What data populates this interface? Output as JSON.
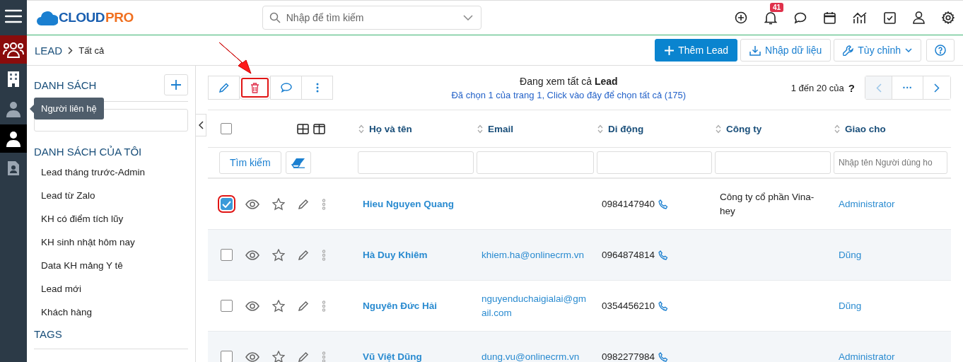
{
  "logo": {
    "part_1": "CLOUD",
    "part_2": "PRO"
  },
  "search": {
    "placeholder": "Nhập để tìm kiếm"
  },
  "notifications": {
    "count": "41"
  },
  "rail": [
    {
      "kind": "menu",
      "selected": false,
      "hovered": false
    },
    {
      "kind": "people",
      "selected": true,
      "hovered": false
    },
    {
      "kind": "building",
      "selected": false,
      "hovered": false
    },
    {
      "kind": "contact",
      "selected": false,
      "hovered": false
    },
    {
      "kind": "person",
      "selected": false,
      "hovered": true
    },
    {
      "kind": "document",
      "selected": false,
      "hovered": false
    }
  ],
  "tooltip": "Người liên hệ",
  "breadcrumb": {
    "module": "LEAD",
    "current": "Tất cả"
  },
  "actions": {
    "add": "Thêm Lead",
    "import": "Nhập dữ liệu",
    "customize": "Tùy chỉnh"
  },
  "sidebar": {
    "title": "DANH SÁCH",
    "my_lists_title": "DANH SÁCH CỦA TÔI",
    "items": [
      "Lead tháng trước-Admin",
      "Lead từ Zalo",
      "KH có điểm tích lũy",
      "KH sinh nhật hôm nay",
      "Data KH mảng Y tê",
      "Lead mới",
      "Khách hàng"
    ],
    "tags_title": "TAGS"
  },
  "toolbar": [
    {
      "kind": "edit",
      "highlighted": false
    },
    {
      "kind": "delete",
      "highlighted": true
    },
    {
      "kind": "comment",
      "highlighted": false
    },
    {
      "kind": "more",
      "highlighted": false
    }
  ],
  "info": {
    "viewing": "Đang xem tất cả **Lead**",
    "selection": "Đã chọn 1 của trang 1, Click vào đây để chọn tất cả (175)"
  },
  "pagination": {
    "range": "1 đến 20 của",
    "unknown": "?",
    "more": "···"
  },
  "table": {
    "all_selected": false,
    "columns": [
      "Họ và tên",
      "Email",
      "Di động",
      "Công ty",
      "Giao cho"
    ],
    "search_button": "Tìm kiếm",
    "assignee_placeholder": "Nhập tên Người dùng ho",
    "rows": [
      {
        "selected": true,
        "highlighted": true,
        "name": "Hieu Nguyen Quang",
        "email": "",
        "mobile": "0984147940",
        "company": "Công ty cổ phần Vina-hey",
        "assignee": "Administrator"
      },
      {
        "selected": false,
        "highlighted": false,
        "name": "Hà Duy Khiêm",
        "email": "khiem.ha@onlinecrm.vn",
        "mobile": "0964874814",
        "company": "",
        "assignee": "Dũng"
      },
      {
        "selected": false,
        "highlighted": false,
        "name": "Nguyên Đức Hải",
        "email": "nguyenduchaigialai@gmail.com",
        "mobile": "0354456210",
        "company": "",
        "assignee": "Dũng"
      },
      {
        "selected": false,
        "highlighted": false,
        "name": "Vũ Việt Dũng",
        "email": "dung.vu@onlinecrm.vn",
        "mobile": "0982277984",
        "company": "",
        "assignee": "Administrator"
      }
    ]
  }
}
